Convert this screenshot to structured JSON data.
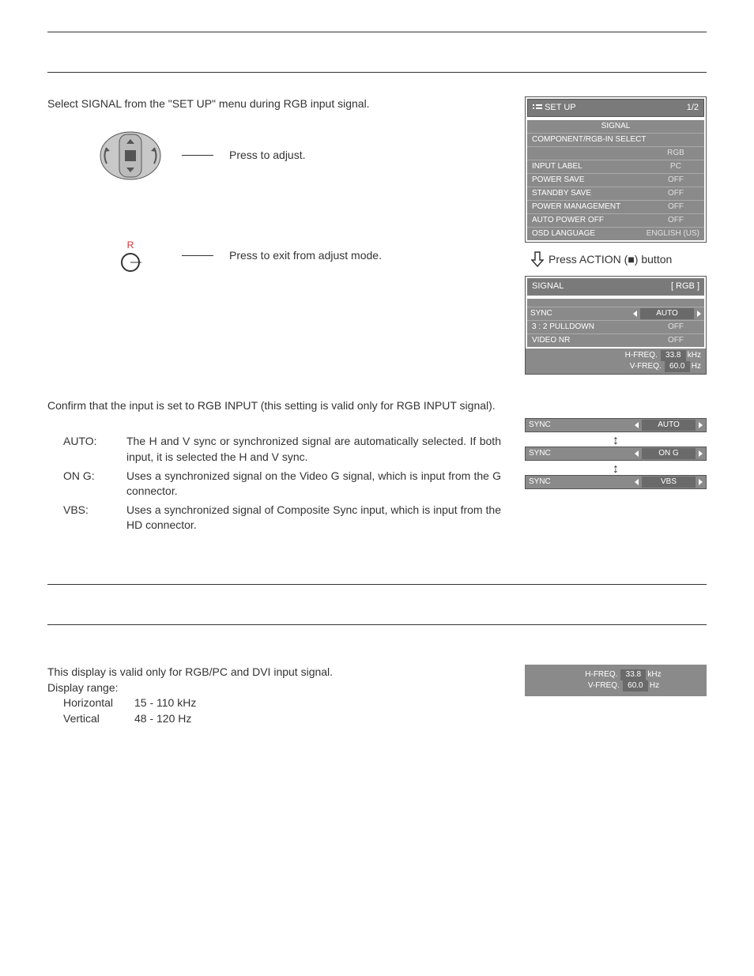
{
  "intro": "Select SIGNAL from the \"SET UP\" menu during RGB input signal.",
  "controls": {
    "adjust": "Press to adjust.",
    "exit": "Press to exit from adjust mode.",
    "r_label": "R"
  },
  "setup_menu": {
    "title": "SET UP",
    "page": "1/2",
    "signal_heading": "SIGNAL",
    "rows": [
      {
        "label": "COMPONENT/RGB-IN SELECT",
        "val": "RGB"
      },
      {
        "label": "INPUT LABEL",
        "val": "PC"
      },
      {
        "label": "POWER SAVE",
        "val": "OFF"
      },
      {
        "label": "STANDBY SAVE",
        "val": "OFF"
      },
      {
        "label": "POWER MANAGEMENT",
        "val": "OFF"
      },
      {
        "label": "AUTO POWER OFF",
        "val": "OFF"
      },
      {
        "label": "OSD LANGUAGE",
        "val": "ENGLISH (US)"
      }
    ]
  },
  "action_hint": "Press ACTION (■) button",
  "signal_menu": {
    "title": "SIGNAL",
    "mode": "[ RGB ]",
    "rows": [
      {
        "label": "SYNC",
        "val": "AUTO",
        "selector": true
      },
      {
        "label": "3 : 2 PULLDOWN",
        "val": "OFF"
      },
      {
        "label": "VIDEO NR",
        "val": "OFF"
      }
    ],
    "freq": [
      {
        "lbl": "H-FREQ.",
        "num": "33.8",
        "unit": "kHz"
      },
      {
        "lbl": "V-FREQ.",
        "num": "60.0",
        "unit": "Hz"
      }
    ]
  },
  "confirm_text": "Confirm that the input is set to RGB INPUT (this setting is valid only for RGB INPUT signal).",
  "definitions": [
    {
      "term": "AUTO:",
      "desc": "The H and V sync or synchronized signal are automatically selected. If both input, it is selected the H and V sync."
    },
    {
      "term": "ON G:",
      "desc": "Uses a synchronized signal on the Video G signal, which is input from the G connector."
    },
    {
      "term": "VBS:",
      "desc": "Uses a synchronized signal of Composite Sync input, which is input from the HD connector."
    }
  ],
  "sync_stack": [
    {
      "label": "SYNC",
      "val": "AUTO"
    },
    {
      "label": "SYNC",
      "val": "ON G"
    },
    {
      "label": "SYNC",
      "val": "VBS"
    }
  ],
  "freq_note": {
    "text": "This display is valid only for RGB/PC and DVI input signal.",
    "range_label": "Display range:",
    "ranges": [
      {
        "label": "Horizontal",
        "val": "15 - 110 kHz"
      },
      {
        "label": "Vertical",
        "val": "48 - 120 Hz"
      }
    ],
    "freq": [
      {
        "lbl": "H-FREQ.",
        "num": "33.8",
        "unit": "kHz"
      },
      {
        "lbl": "V-FREQ.",
        "num": "60.0",
        "unit": "Hz"
      }
    ]
  }
}
